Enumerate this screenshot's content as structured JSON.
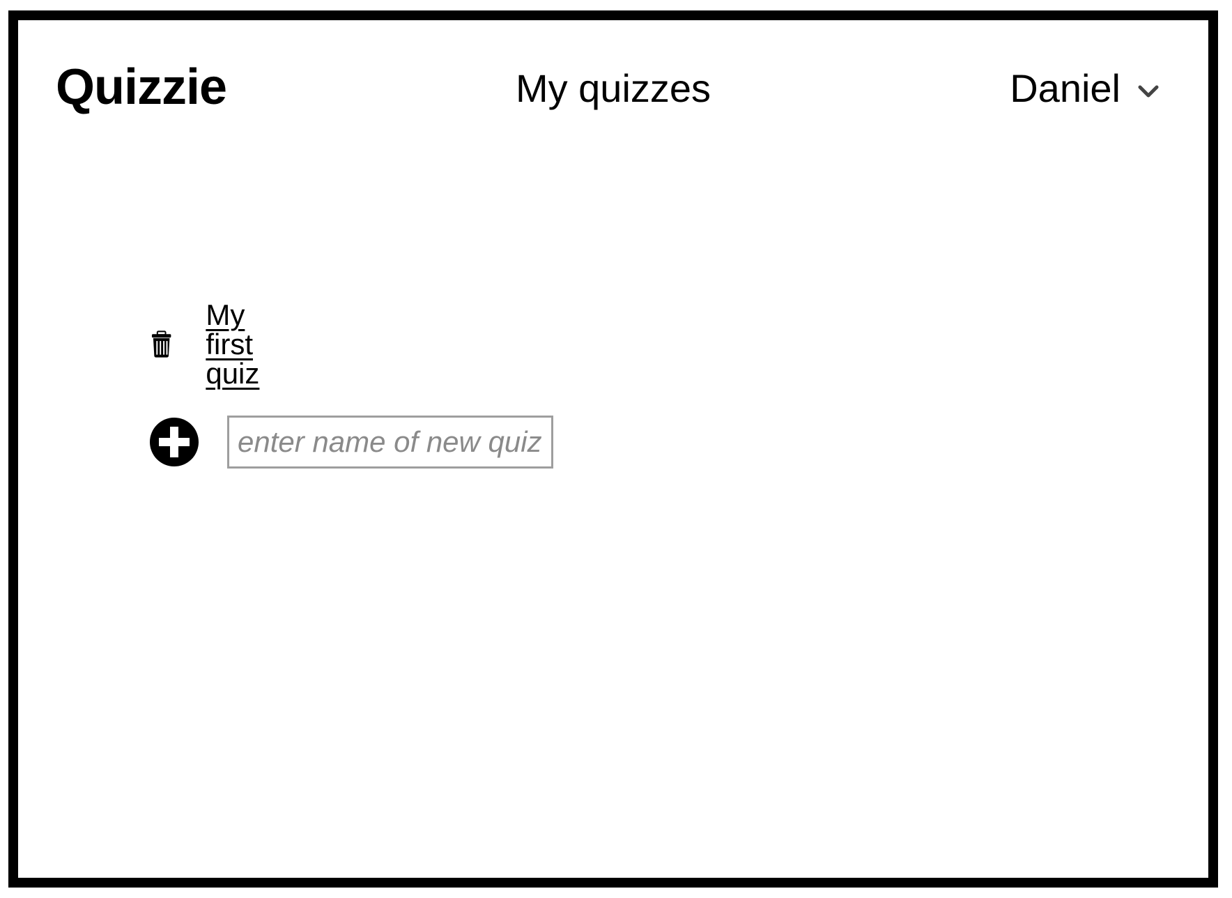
{
  "header": {
    "brand": "Quizzie",
    "page_title": "My quizzes",
    "user_name": "Daniel",
    "user_menu_icon": "chevron-down-icon"
  },
  "quizzes": [
    {
      "title": "My first quiz",
      "delete_icon": "trash-icon"
    }
  ],
  "new_quiz": {
    "add_icon": "plus-circle-icon",
    "placeholder": "enter name of new quiz",
    "value": ""
  }
}
